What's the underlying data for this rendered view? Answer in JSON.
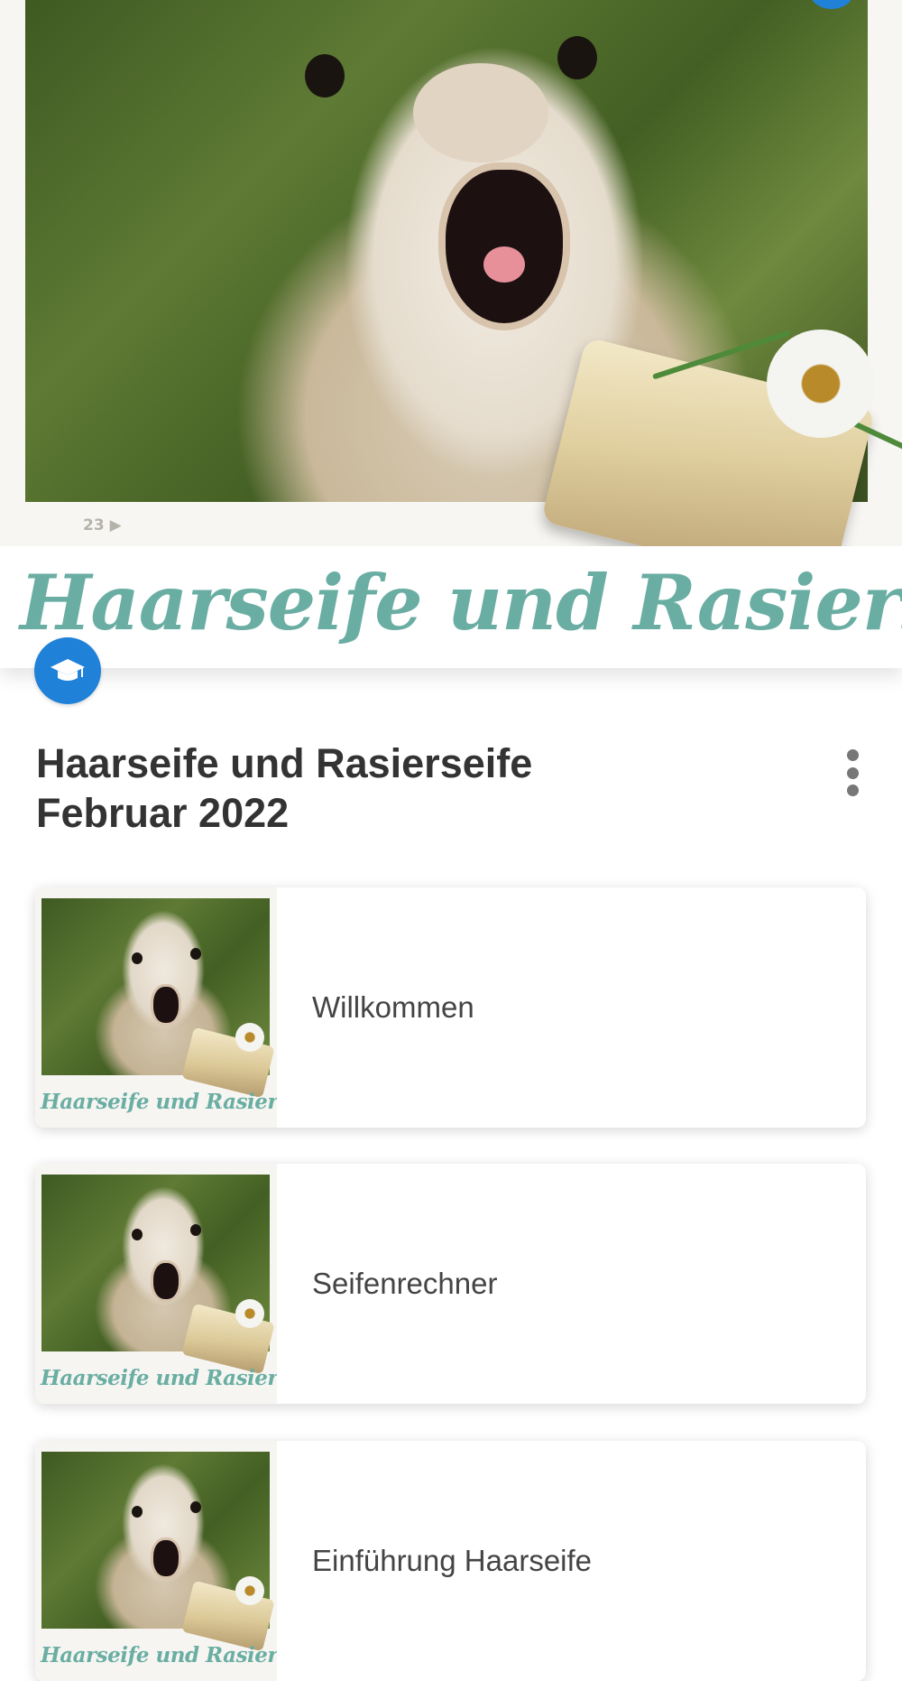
{
  "hero": {
    "title": "Haarseife und Rasierseife",
    "photo_caption": "23 ▶",
    "badge_icon": "graduation-cap-icon"
  },
  "course": {
    "title_line1": "Haarseife und Rasierseife",
    "title_line2": "Februar 2022",
    "menu_icon": "more-vertical-icon"
  },
  "lessons": [
    {
      "label": "Willkommen",
      "thumb_title": "Haarseife und Rasierseife"
    },
    {
      "label": "Seifenrechner",
      "thumb_title": "Haarseife und Rasierseife"
    },
    {
      "label": "Einführung Haarseife",
      "thumb_title": "Haarseife und Rasierseife"
    }
  ],
  "colors": {
    "accent": "#2081d8",
    "title_teal": "#6aaea3",
    "text": "#333333"
  }
}
